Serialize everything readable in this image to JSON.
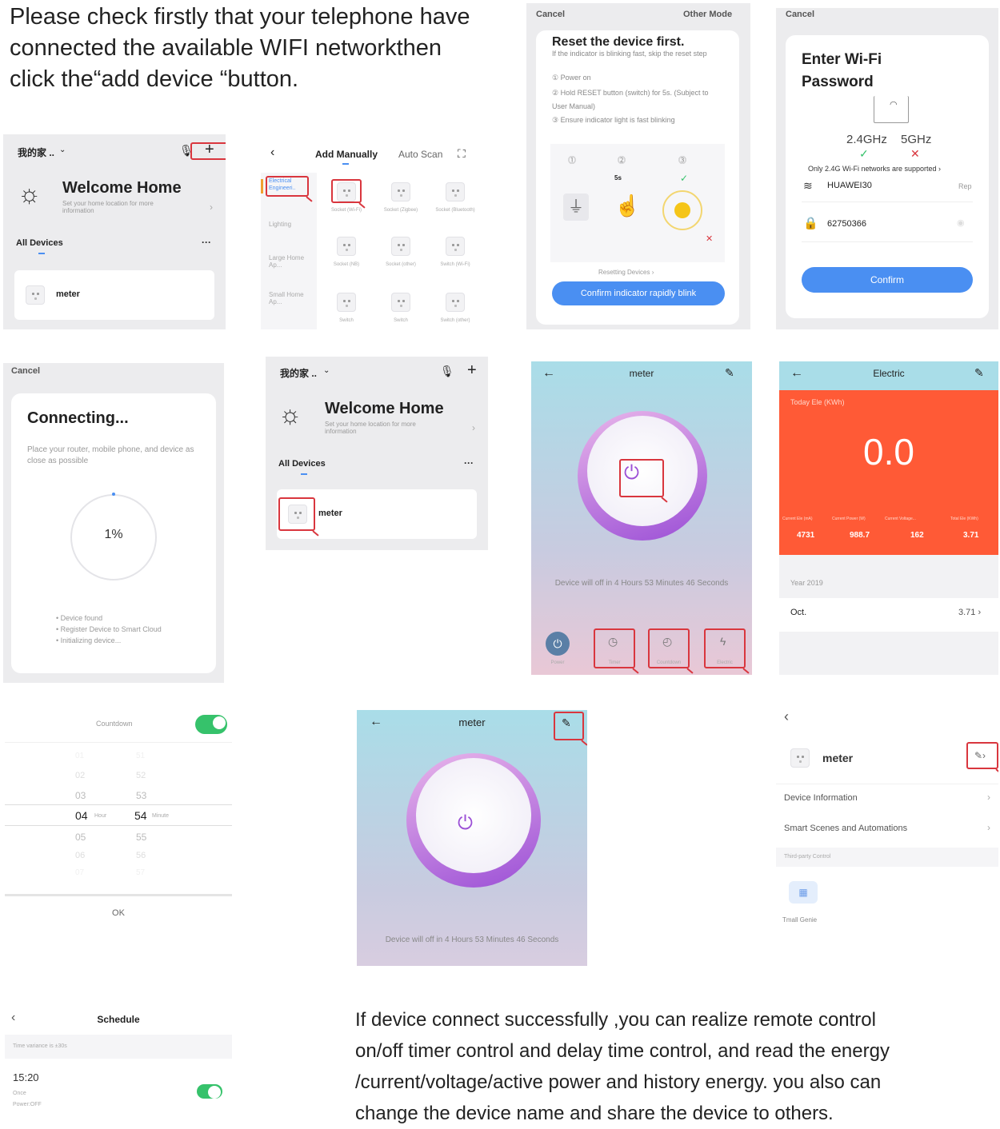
{
  "intro_text": [
    "Please check firstly that your telephone have",
    "connected the available WIFI networkthen",
    "click the“add device “button."
  ],
  "outro_text": [
    "If device connect successfully ,you can realize remote control",
    "on/off timer control and delay time control, and read the energy",
    "/current/voltage/active power and history energy. you also can",
    "change the device name and share the device to others."
  ],
  "home": {
    "home_name": "我的家 ..",
    "title": "Welcome Home",
    "subtitle": "Set your home location for more information",
    "all_devices": "All Devices",
    "more": "···",
    "device": "meter"
  },
  "add": {
    "tab_manual": "Add Manually",
    "tab_auto": "Auto Scan",
    "categories": [
      "Electrical Engineeri..",
      "Lighting",
      "Large Home Ap...",
      "Small Home Ap..."
    ],
    "items": [
      "Socket (Wi-Fi)",
      "Socket (Zigbee)",
      "Socket (Bluetooth)",
      "Socket (NB)",
      "Socket (other)",
      "Switch (Wi-Fi)",
      "Switch",
      "Switch",
      "Switch (other)"
    ]
  },
  "reset": {
    "cancel": "Cancel",
    "other_mode": "Other Mode",
    "title": "Reset the device first.",
    "subtitle": "If the indicator is blinking fast, skip the reset step",
    "step1": "① Power on",
    "step2": "② Hold RESET button (switch) for 5s. (Subject to User Manual)",
    "step3": "③ Ensure indicator light is fast blinking",
    "hold_label": "5s",
    "link": "Resetting Devices ›",
    "confirm": "Confirm indicator rapidly blink"
  },
  "wifi": {
    "cancel": "Cancel",
    "title1": "Enter Wi-Fi",
    "title2": "Password",
    "band1": "2.4GHz",
    "band2": "5GHz",
    "note": "Only 2.4G Wi-Fi networks are supported ›",
    "ssid": "HUAWEI30",
    "ssid_action": "Rep",
    "password": "62750366",
    "confirm": "Confirm"
  },
  "connecting": {
    "cancel": "Cancel",
    "title": "Connecting...",
    "desc": "Place your router, mobile phone, and device as close as possible",
    "percent": "1%",
    "steps": [
      "Device found",
      "Register Device to Smart Cloud",
      "Initializing device..."
    ]
  },
  "meter": {
    "title": "meter",
    "countdown_text": "Device will off in 4 Hours 53 Minutes 46 Seconds",
    "buttons": [
      "Power",
      "Timer",
      "Countdown",
      "Electric"
    ]
  },
  "electric": {
    "title": "Electric",
    "today_label": "Today Ele (KWh)",
    "today_value": "0.0",
    "stat_labels": [
      "Current Ele (mA)",
      "Current Power (W)",
      "Current Voltage...",
      "Total Ele (KWh)"
    ],
    "stat_values": [
      "4731",
      "988.7",
      "162",
      "3.71"
    ],
    "year": "Year 2019",
    "month": "Oct.",
    "month_value": "3.71 ›"
  },
  "countdown": {
    "label": "Countdown",
    "hours": [
      "01",
      "02",
      "03",
      "04",
      "05",
      "06",
      "07"
    ],
    "minutes": [
      "51",
      "52",
      "53",
      "54",
      "55",
      "56",
      "57"
    ],
    "hour_unit": "Hour",
    "minute_unit": "Minute",
    "ok": "OK"
  },
  "settings": {
    "device": "meter",
    "items": [
      "Device Information",
      "Smart Scenes and Automations"
    ],
    "section": "Third-party Control",
    "third_party": "Tmall Genie"
  },
  "schedule": {
    "title": "Schedule",
    "note": "Time variance is ±30s",
    "time": "15:20",
    "repeat": "Once",
    "action": "Power:OFF"
  },
  "colors": {
    "blue": "#4a8ff2",
    "red": "#d9363e",
    "orange": "#ff5a36",
    "green": "#36c26b",
    "purple": "#9b4fd6"
  }
}
